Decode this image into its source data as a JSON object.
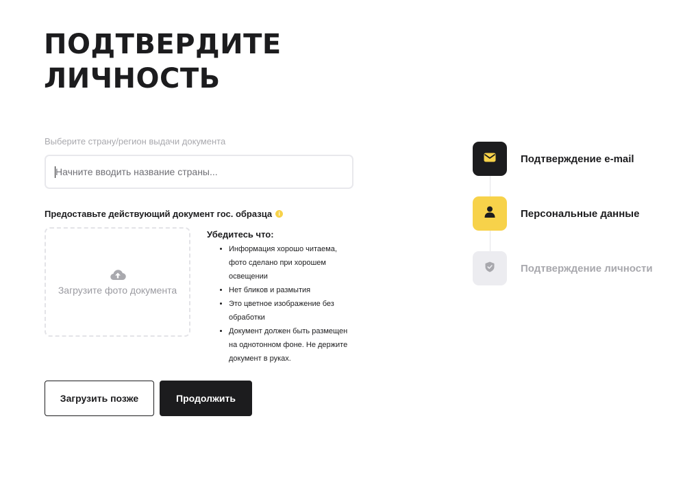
{
  "title": {
    "line1": "ПОДТВЕРДИТЕ",
    "line2": "ЛИЧНОСТЬ"
  },
  "country": {
    "label": "Выберите страну/регион выдачи документа",
    "placeholder": "Начните вводить название страны...",
    "value": ""
  },
  "document": {
    "heading": "Предоставьте действующий документ гос. образца",
    "info_icon": "i",
    "upload_label": "Загрузите фото документа",
    "upload_icon": "cloud-upload-icon"
  },
  "hints": {
    "title": "Убедитесь что:",
    "items": [
      "Информация хорошо читаема, фото сделано при хорошем освещении",
      "Нет бликов и размытия",
      "Это цветное изображение без обработки",
      "Документ должен быть размещен на однотонном фоне. Не держите документ в руках."
    ]
  },
  "buttons": {
    "later": "Загрузить позже",
    "continue": "Продолжить"
  },
  "steps": [
    {
      "label": "Подтверждение e-mail",
      "icon": "mail-icon",
      "state": "completed"
    },
    {
      "label": "Персональные данные",
      "icon": "user-icon",
      "state": "current"
    },
    {
      "label": "Подтверждение личности",
      "icon": "shield-check-icon",
      "state": "upcoming"
    }
  ],
  "colors": {
    "primary": "#1c1c1e",
    "accent": "#f7d24a",
    "muted": "#a8a8ad",
    "border": "#e8e8ec"
  }
}
